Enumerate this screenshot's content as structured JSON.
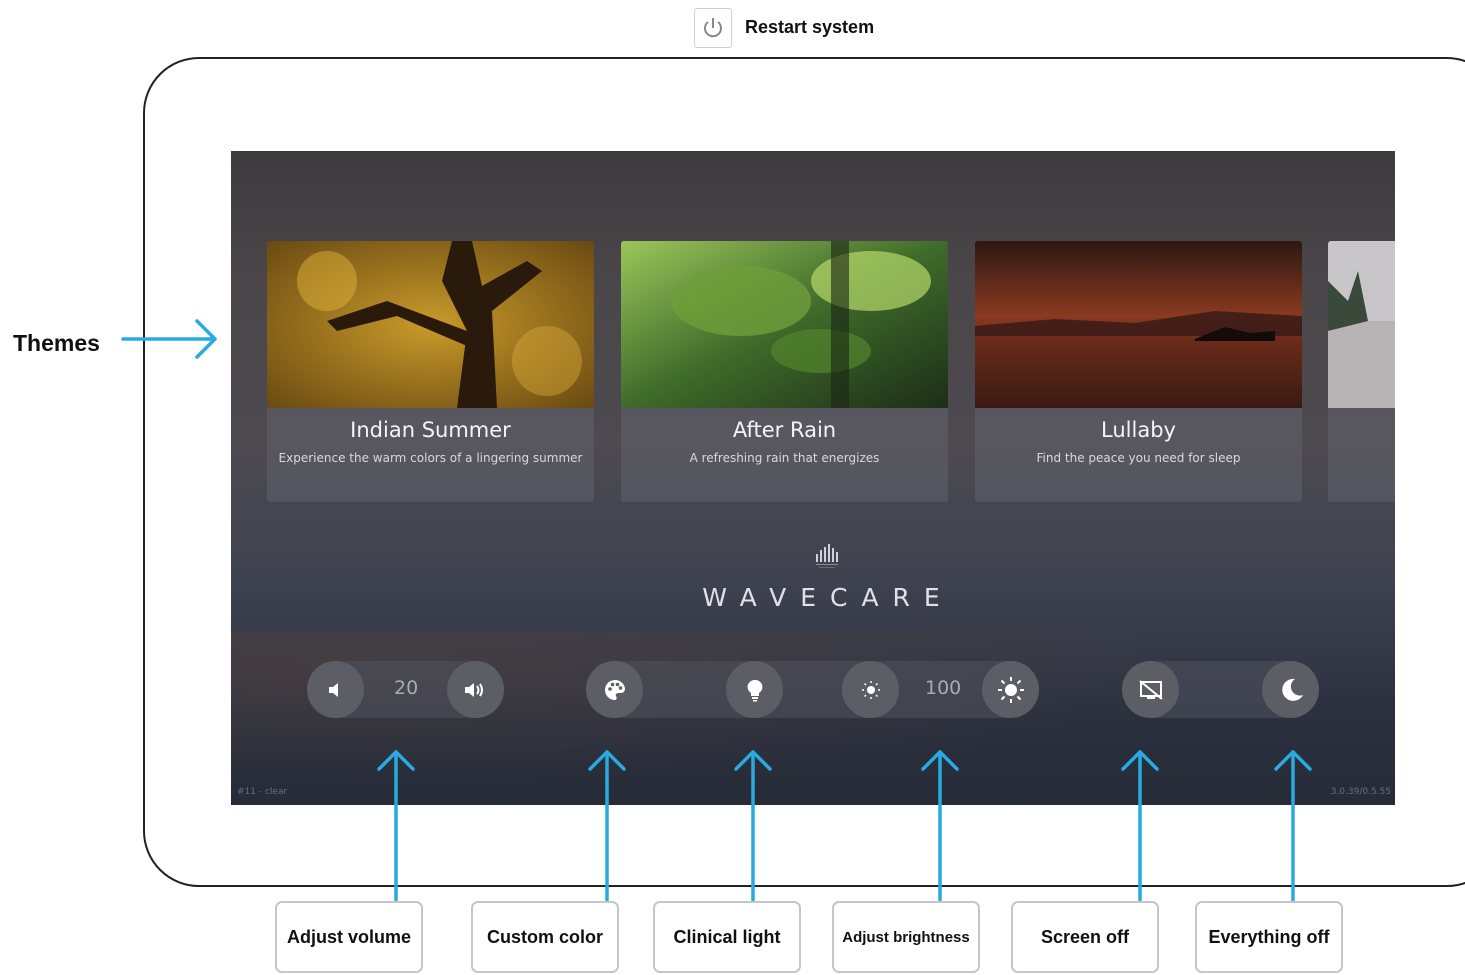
{
  "header": {
    "restart_label": "Restart system"
  },
  "themes_label": "Themes",
  "cards": [
    {
      "title": "Indian Summer",
      "description": "Experience the warm colors of a lingering summer"
    },
    {
      "title": "After Rain",
      "description": "A refreshing rain that energizes"
    },
    {
      "title": "Lullaby",
      "description": "Find the peace you need for sleep"
    }
  ],
  "brand": "WAVECARE",
  "controls": {
    "volume": "20",
    "brightness": "100"
  },
  "corner": {
    "left": "#11 - clear",
    "right": "3.0.39/0.5.55"
  },
  "callouts": [
    "Adjust volume",
    "Custom color",
    "Clinical light",
    "Adjust brightness",
    "Screen off",
    "Everything off"
  ],
  "colors": {
    "arrow": "#29abe2",
    "screen": "#3a3a40",
    "button": "#5c5d65"
  }
}
